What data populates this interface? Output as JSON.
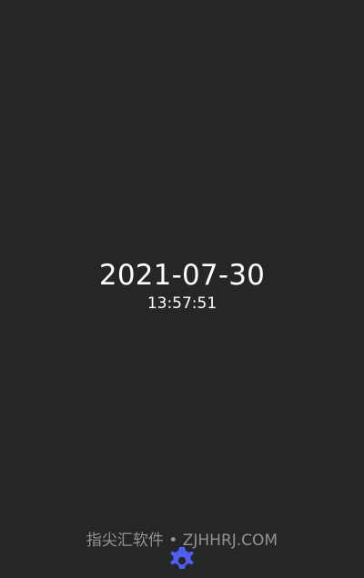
{
  "clock": {
    "date": "2021-07-30",
    "time": "13:57:51"
  },
  "watermark": {
    "text": "指尖汇软件 • ZJHHRJ.COM"
  },
  "settings_button": {
    "icon": "gear-icon",
    "color": "#4f5ef0"
  },
  "colors": {
    "background": "#252727",
    "text": "#ffffff"
  }
}
